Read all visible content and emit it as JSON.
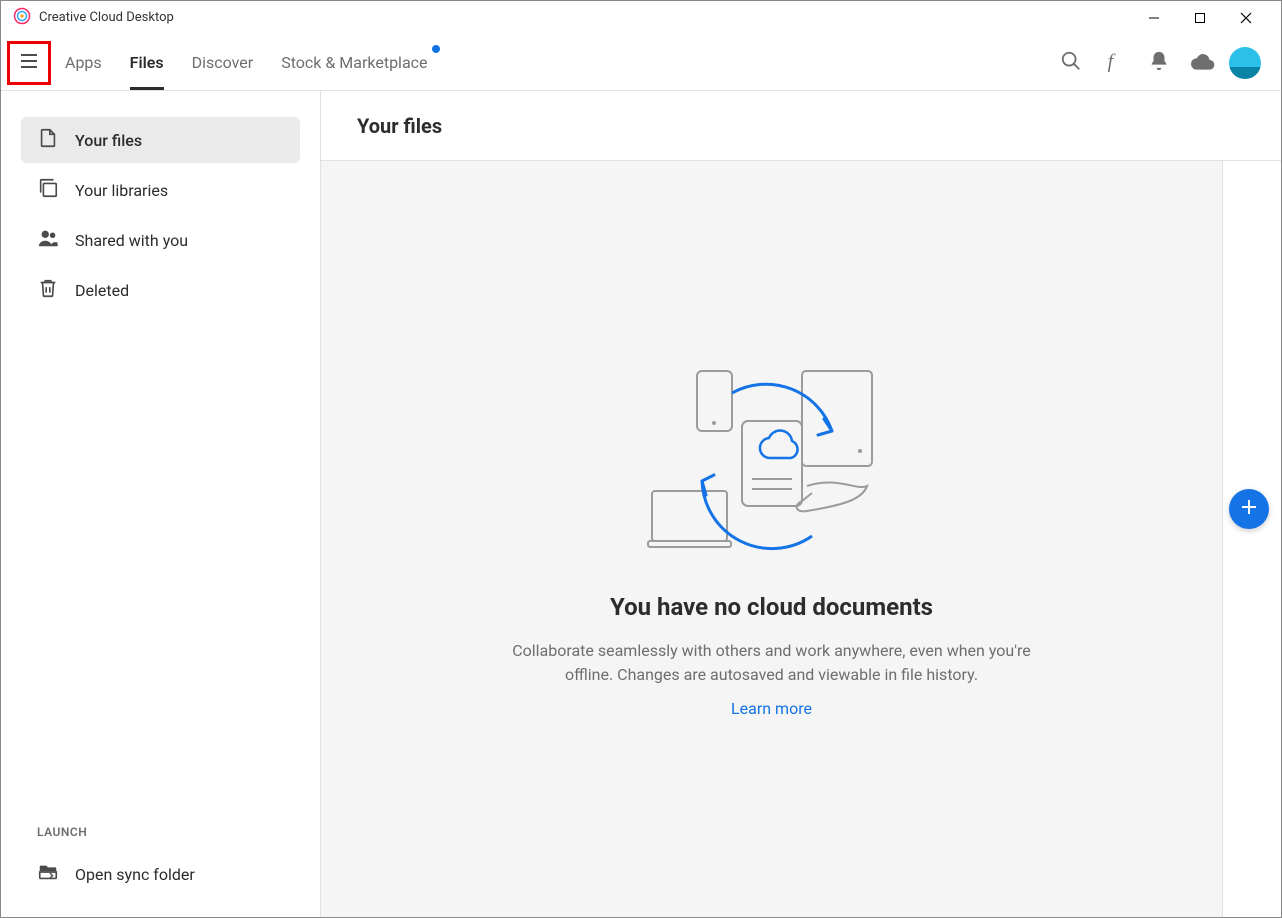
{
  "window": {
    "title": "Creative Cloud Desktop"
  },
  "nav": {
    "tabs": [
      {
        "label": "Apps"
      },
      {
        "label": "Files"
      },
      {
        "label": "Discover"
      },
      {
        "label": "Stock & Marketplace"
      }
    ]
  },
  "sidebar": {
    "items": [
      {
        "label": "Your files"
      },
      {
        "label": "Your libraries"
      },
      {
        "label": "Shared with you"
      },
      {
        "label": "Deleted"
      }
    ],
    "launch_label": "LAUNCH",
    "launch_item": "Open sync folder"
  },
  "main": {
    "title": "Your files",
    "empty_title": "You have no cloud documents",
    "empty_desc": "Collaborate seamlessly with others and work anywhere, even when you're offline. Changes are autosaved and viewable in file history.",
    "learn_more": "Learn more"
  },
  "colors": {
    "accent": "#1473e6",
    "avatar": "#2cc0e8"
  }
}
